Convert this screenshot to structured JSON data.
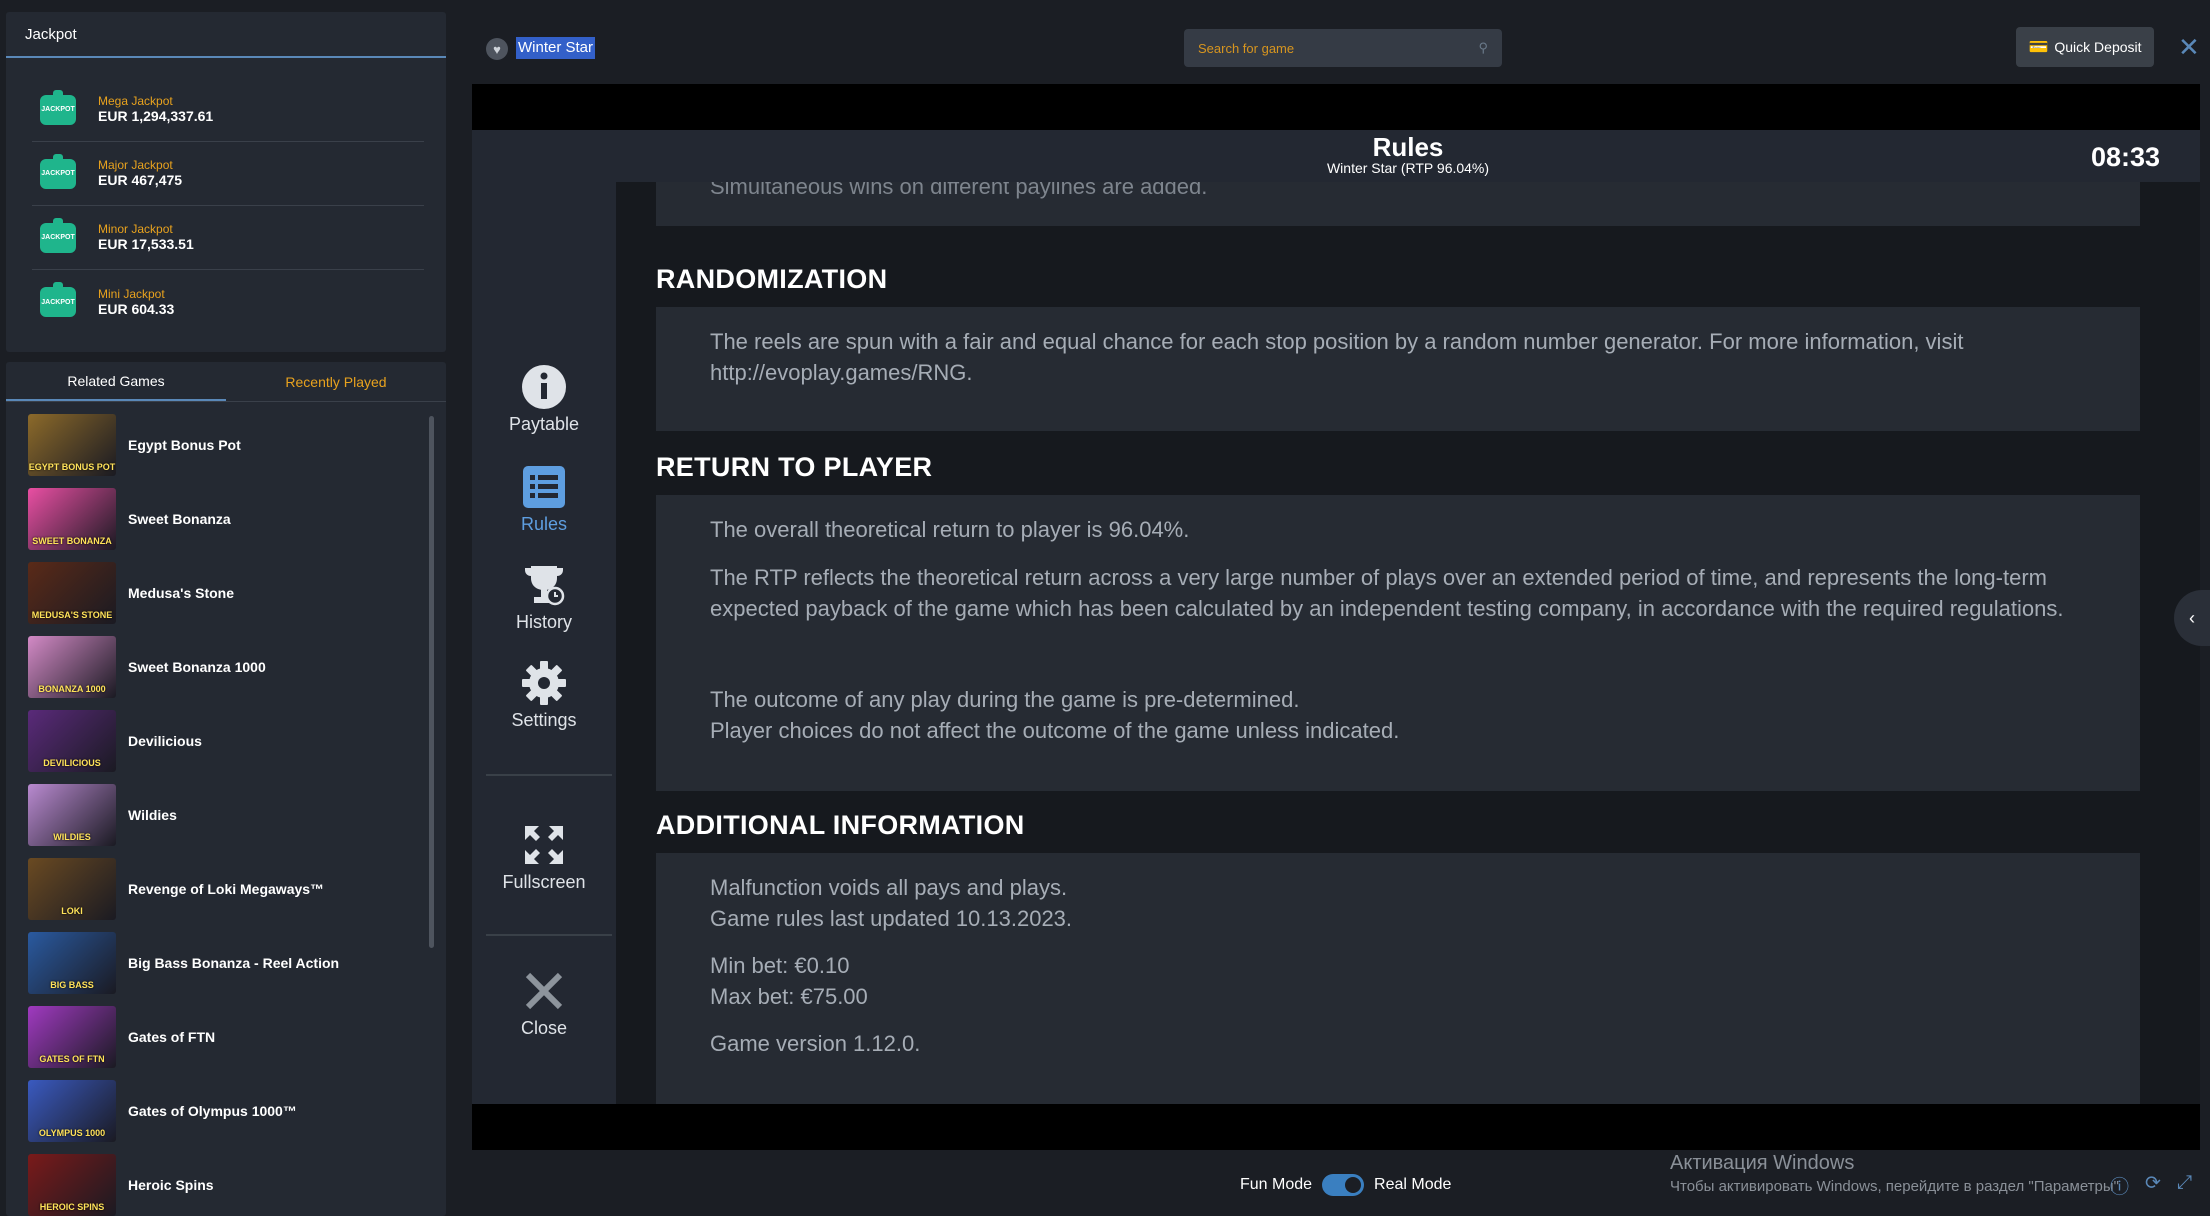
{
  "jackpot": {
    "title": "Jackpot",
    "items": [
      {
        "name": "Mega Jackpot",
        "value": "EUR 1,294,337.61"
      },
      {
        "name": "Major Jackpot",
        "value": "EUR 467,475"
      },
      {
        "name": "Minor Jackpot",
        "value": "EUR 17,533.51"
      },
      {
        "name": "Mini Jackpot",
        "value": "EUR 604.33"
      }
    ],
    "icon_text": "JACKPOT"
  },
  "games": {
    "tabs": [
      "Related Games",
      "Recently Played"
    ],
    "list": [
      {
        "name": "Egypt Bonus Pot",
        "thumb": "EGYPT BONUS POT",
        "color": "#8c6a2a"
      },
      {
        "name": "Sweet Bonanza",
        "thumb": "SWEET BONANZA",
        "color": "#e94fa3"
      },
      {
        "name": "Medusa's Stone",
        "thumb": "MEDUSA'S STONE",
        "color": "#5a2a18"
      },
      {
        "name": "Sweet Bonanza 1000",
        "thumb": "BONANZA 1000",
        "color": "#d38ac6"
      },
      {
        "name": "Devilicious",
        "thumb": "DEVILICIOUS",
        "color": "#5a2a7a"
      },
      {
        "name": "Wildies",
        "thumb": "WILDIES",
        "color": "#b98ad0"
      },
      {
        "name": "Revenge of Loki Megaways™",
        "thumb": "LOKI",
        "color": "#6a4a22"
      },
      {
        "name": "Big Bass Bonanza - Reel Action",
        "thumb": "BIG BASS",
        "color": "#2a5aa0"
      },
      {
        "name": "Gates of FTN",
        "thumb": "GATES OF FTN",
        "color": "#a03ac0"
      },
      {
        "name": "Gates of Olympus 1000™",
        "thumb": "OLYMPUS 1000",
        "color": "#3a5ac0"
      },
      {
        "name": "Heroic Spins",
        "thumb": "HEROIC SPINS",
        "color": "#7a1a1a"
      }
    ]
  },
  "header": {
    "game_title": "Winter Star",
    "search_placeholder": "Search for game",
    "quick_deposit": "Quick Deposit"
  },
  "menu": {
    "items": [
      {
        "label": "Paytable",
        "icon": "info-icon"
      },
      {
        "label": "Rules",
        "icon": "list-icon"
      },
      {
        "label": "History",
        "icon": "trophy-icon"
      },
      {
        "label": "Settings",
        "icon": "gear-icon"
      },
      {
        "label": "Fullscreen",
        "icon": "fullscreen-icon"
      },
      {
        "label": "Close",
        "icon": "close-icon"
      }
    ],
    "active": "Rules"
  },
  "rules": {
    "title": "Rules",
    "subtitle": "Winter Star (RTP 96.04%)",
    "time": "08:33",
    "cut_text": "Simultaneous wins on different paylines are added.",
    "sections": [
      {
        "title": "RANDOMIZATION",
        "paragraphs": [
          "The reels are spun with a fair and equal chance for each stop position by a random number generator. For more information, visit http://evoplay.games/RNG."
        ]
      },
      {
        "title": "RETURN TO PLAYER",
        "paragraphs": [
          "The overall theoretical return to player is 96.04%.",
          "The RTP reflects the theoretical return across a very large number of plays over an extended period of time, and represents the long-term expected payback of the game which has been calculated by an independent testing company, in accordance with the required regulations.",
          "The outcome of any play during the game is pre-determined.",
          "Player choices do not affect the outcome of the game unless indicated."
        ]
      },
      {
        "title": "ADDITIONAL INFORMATION",
        "paragraphs": [
          "Malfunction voids all pays and plays.",
          "Game rules last updated 10.13.2023.",
          "Min bet: €0.10",
          "Max bet: €75.00",
          "Game version 1.12.0."
        ]
      }
    ]
  },
  "footer": {
    "fun_mode": "Fun Mode",
    "real_mode": "Real Mode",
    "win_title": "Активация Windows",
    "win_sub": "Чтобы активировать Windows, перейдите в раздел \"Параметры\""
  }
}
